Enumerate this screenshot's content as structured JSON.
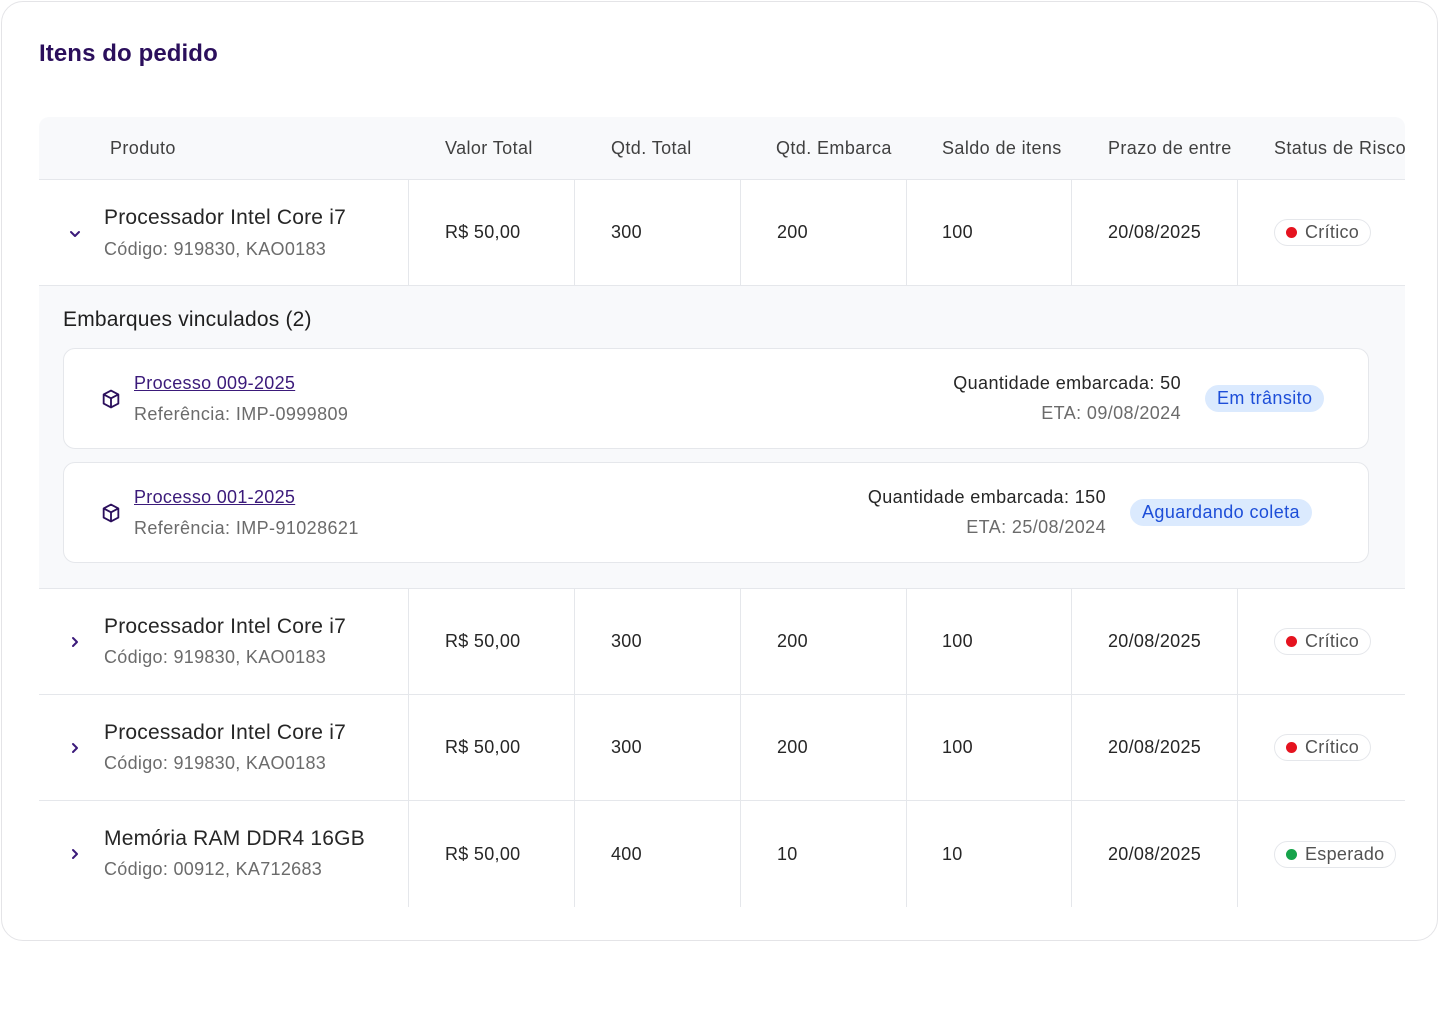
{
  "title": "Itens do pedido",
  "columns": [
    "Produto",
    "Valor Total",
    "Qtd. Total",
    "Qtd. Embarcada",
    "Saldo de itens",
    "Prazo de entrega",
    "Status de Risco"
  ],
  "columns_display": [
    "Produto",
    "Valor Total",
    "Qtd. Total",
    "Qtd. Embarca",
    "Saldo de itens",
    "Prazo de entre",
    "Status de Risco"
  ],
  "rows": [
    {
      "name": "Processador Intel Core i7",
      "code": "Código: 919830, KAO0183",
      "valor": "R$ 50,00",
      "qtd_total": "300",
      "qtd_embarcada": "200",
      "saldo": "100",
      "prazo": "20/08/2025",
      "status": "Crítico",
      "status_color": "#e5131f",
      "expanded": true
    },
    {
      "name": "Processador Intel Core i7",
      "code": "Código: 919830, KAO0183",
      "valor": "R$ 50,00",
      "qtd_total": "300",
      "qtd_embarcada": "200",
      "saldo": "100",
      "prazo": "20/08/2025",
      "status": "Crítico",
      "status_color": "#e5131f",
      "expanded": false
    },
    {
      "name": "Processador Intel Core i7",
      "code": "Código: 919830, KAO0183",
      "valor": "R$ 50,00",
      "qtd_total": "300",
      "qtd_embarcada": "200",
      "saldo": "100",
      "prazo": "20/08/2025",
      "status": "Crítico",
      "status_color": "#e5131f",
      "expanded": false
    },
    {
      "name": "Memória RAM DDR4 16GB",
      "code": "Código: 00912, KA712683",
      "valor": "R$ 50,00",
      "qtd_total": "400",
      "qtd_embarcada": "10",
      "saldo": "10",
      "prazo": "20/08/2025",
      "status": "Esperado",
      "status_color": "#16a34a",
      "expanded": false
    }
  ],
  "shipments": {
    "title": "Embarques vinculados (2)",
    "items": [
      {
        "process": "Processo 009-2025",
        "reference": "Referência: IMP-0999809",
        "quantity": "Quantidade embarcada: 50",
        "eta": "ETA: 09/08/2024",
        "status": "Em trânsito"
      },
      {
        "process": "Processo 001-2025",
        "reference": "Referência: IMP-91028621",
        "quantity": "Quantidade embarcada: 150",
        "eta": "ETA: 25/08/2024",
        "status": "Aguardando coleta"
      }
    ]
  },
  "icons": {
    "expand_open": "chevron-down-icon",
    "expand_closed": "chevron-right-icon",
    "shipment": "box-icon",
    "status_dot": "dot-icon"
  },
  "colors": {
    "title": "#2b0f5c",
    "link": "#3b1a7a",
    "badge_bg": "#dbeafe",
    "badge_text": "#1d4ed8",
    "critical": "#e5131f",
    "expected": "#16a34a",
    "header_bg": "#f8f9fb"
  }
}
